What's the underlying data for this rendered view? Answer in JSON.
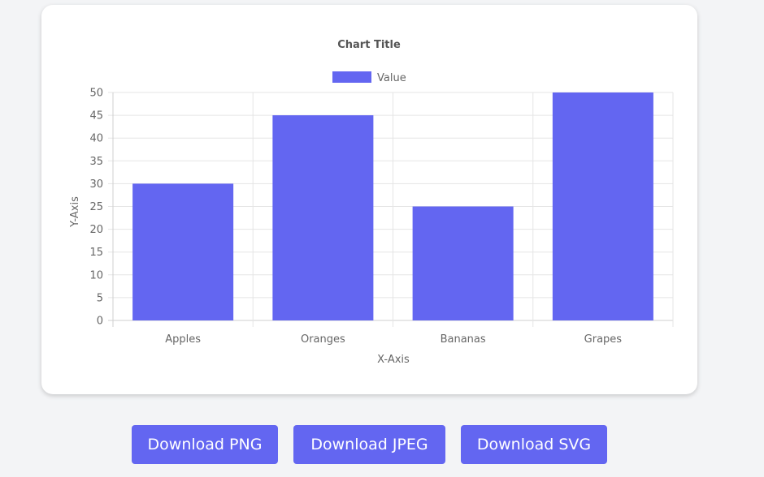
{
  "chart_data": {
    "type": "bar",
    "title": "Chart Title",
    "xlabel": "X-Axis",
    "ylabel": "Y-Axis",
    "categories": [
      "Apples",
      "Oranges",
      "Bananas",
      "Grapes"
    ],
    "series": [
      {
        "name": "Value",
        "values": [
          30,
          45,
          25,
          50
        ]
      }
    ],
    "ylim": [
      0,
      50
    ],
    "yticks": [
      "0",
      "5",
      "10",
      "15",
      "20",
      "25",
      "30",
      "35",
      "40",
      "45",
      "50"
    ],
    "grid": true,
    "legend_position": "top",
    "bar_color": "#6366f1"
  },
  "buttons": {
    "png_label": "Download PNG",
    "jpeg_label": "Download JPEG",
    "svg_label": "Download SVG"
  }
}
